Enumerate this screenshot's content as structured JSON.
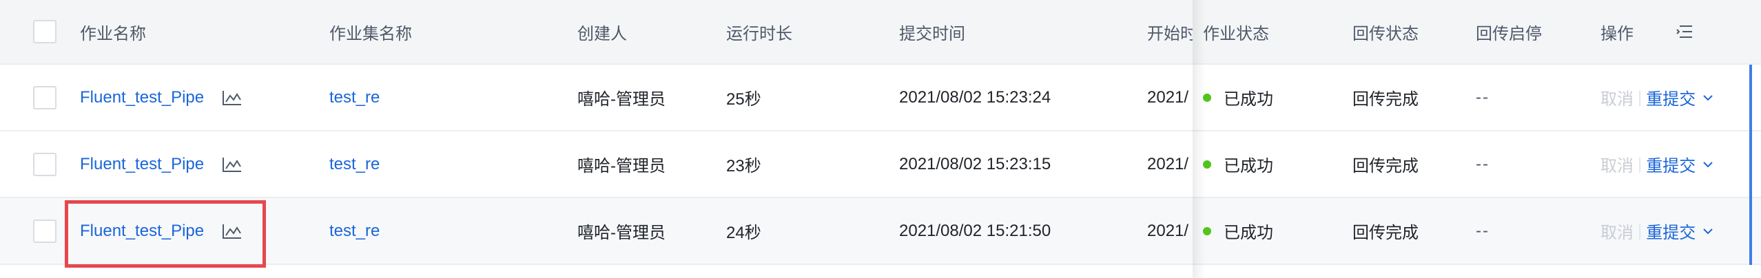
{
  "colors": {
    "link": "#1a66d9",
    "success_dot": "#52c41a",
    "highlight": "#e5484d",
    "header_bg": "#f4f5f7"
  },
  "header": {
    "job_name": "作业名称",
    "job_set_name": "作业集名称",
    "creator": "创建人",
    "run_duration": "运行时长",
    "submit_time": "提交时间",
    "start_time": "开始时",
    "job_status": "作业状态",
    "transmit_status": "回传状态",
    "transmit_toggle": "回传启停",
    "operations": "操作",
    "settings_icon": "list-settings-icon"
  },
  "rows": [
    {
      "job_name": "Fluent_test_Pipe",
      "job_set_name": "test_re",
      "creator": "嘻哈-管理员",
      "run_duration": "25秒",
      "submit_time": "2021/08/02 15:23:24",
      "start_time": "2021/",
      "status": "已成功",
      "transmit_status": "回传完成",
      "transmit_toggle": "--",
      "op_cancel": "取消",
      "op_resubmit": "重提交"
    },
    {
      "job_name": "Fluent_test_Pipe",
      "job_set_name": "test_re",
      "creator": "嘻哈-管理员",
      "run_duration": "23秒",
      "submit_time": "2021/08/02 15:23:15",
      "start_time": "2021/",
      "status": "已成功",
      "transmit_status": "回传完成",
      "transmit_toggle": "--",
      "op_cancel": "取消",
      "op_resubmit": "重提交"
    },
    {
      "job_name": "Fluent_test_Pipe",
      "job_set_name": "test_re",
      "creator": "嘻哈-管理员",
      "run_duration": "24秒",
      "submit_time": "2021/08/02 15:21:50",
      "start_time": "2021/",
      "status": "已成功",
      "transmit_status": "回传完成",
      "transmit_toggle": "--",
      "op_cancel": "取消",
      "op_resubmit": "重提交"
    }
  ]
}
